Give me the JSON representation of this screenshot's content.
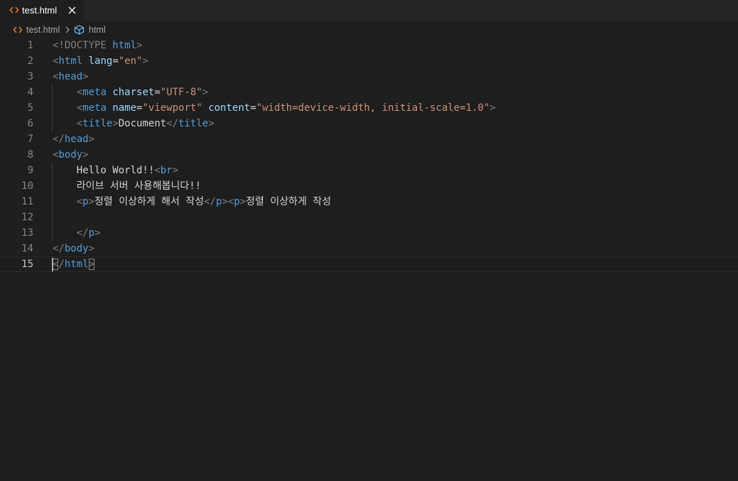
{
  "tab": {
    "label": "test.html",
    "icon": "html-file-icon",
    "close_icon": "close-icon",
    "accent": "#e37933"
  },
  "breadcrumb": {
    "file": "test.html",
    "element": "html",
    "separator_icon": "chevron-right-icon",
    "element_icon": "cube-icon"
  },
  "editor": {
    "current_line": 15,
    "lines": [
      {
        "num": "1",
        "tokens": [
          {
            "t": "<!DOCTYPE ",
            "c": "t-br"
          },
          {
            "t": "html",
            "c": "t-tag"
          },
          {
            "t": ">",
            "c": "t-br"
          }
        ]
      },
      {
        "num": "2",
        "tokens": [
          {
            "t": "<",
            "c": "t-br"
          },
          {
            "t": "html",
            "c": "t-tag"
          },
          {
            "t": " ",
            "c": "t-txt"
          },
          {
            "t": "lang",
            "c": "t-attr"
          },
          {
            "t": "=",
            "c": "t-txt"
          },
          {
            "t": "\"en\"",
            "c": "t-str"
          },
          {
            "t": ">",
            "c": "t-br"
          }
        ]
      },
      {
        "num": "3",
        "tokens": [
          {
            "t": "<",
            "c": "t-br"
          },
          {
            "t": "head",
            "c": "t-tag"
          },
          {
            "t": ">",
            "c": "t-br"
          }
        ]
      },
      {
        "num": "4",
        "tokens": [
          {
            "t": "    ",
            "c": "t-txt"
          },
          {
            "t": "<",
            "c": "t-br"
          },
          {
            "t": "meta",
            "c": "t-tag"
          },
          {
            "t": " ",
            "c": "t-txt"
          },
          {
            "t": "charset",
            "c": "t-attr"
          },
          {
            "t": "=",
            "c": "t-txt"
          },
          {
            "t": "\"UTF-8\"",
            "c": "t-str"
          },
          {
            "t": ">",
            "c": "t-br"
          }
        ]
      },
      {
        "num": "5",
        "tokens": [
          {
            "t": "    ",
            "c": "t-txt"
          },
          {
            "t": "<",
            "c": "t-br"
          },
          {
            "t": "meta",
            "c": "t-tag"
          },
          {
            "t": " ",
            "c": "t-txt"
          },
          {
            "t": "name",
            "c": "t-attr"
          },
          {
            "t": "=",
            "c": "t-txt"
          },
          {
            "t": "\"viewport\"",
            "c": "t-str"
          },
          {
            "t": " ",
            "c": "t-txt"
          },
          {
            "t": "content",
            "c": "t-attr"
          },
          {
            "t": "=",
            "c": "t-txt"
          },
          {
            "t": "\"width=device-width, initial-scale=1.0\"",
            "c": "t-str"
          },
          {
            "t": ">",
            "c": "t-br"
          }
        ]
      },
      {
        "num": "6",
        "tokens": [
          {
            "t": "    ",
            "c": "t-txt"
          },
          {
            "t": "<",
            "c": "t-br"
          },
          {
            "t": "title",
            "c": "t-tag"
          },
          {
            "t": ">",
            "c": "t-br"
          },
          {
            "t": "Document",
            "c": "t-txt"
          },
          {
            "t": "</",
            "c": "t-br"
          },
          {
            "t": "title",
            "c": "t-tag"
          },
          {
            "t": ">",
            "c": "t-br"
          }
        ]
      },
      {
        "num": "7",
        "tokens": [
          {
            "t": "</",
            "c": "t-br"
          },
          {
            "t": "head",
            "c": "t-tag"
          },
          {
            "t": ">",
            "c": "t-br"
          }
        ]
      },
      {
        "num": "8",
        "tokens": [
          {
            "t": "<",
            "c": "t-br"
          },
          {
            "t": "body",
            "c": "t-tag"
          },
          {
            "t": ">",
            "c": "t-br"
          }
        ]
      },
      {
        "num": "9",
        "tokens": [
          {
            "t": "    Hello World!!",
            "c": "t-txt"
          },
          {
            "t": "<",
            "c": "t-br"
          },
          {
            "t": "br",
            "c": "t-tag"
          },
          {
            "t": ">",
            "c": "t-br"
          }
        ]
      },
      {
        "num": "10",
        "tokens": [
          {
            "t": "    라이브 서버 사용해봅니다!!",
            "c": "t-txt"
          }
        ]
      },
      {
        "num": "11",
        "tokens": [
          {
            "t": "    ",
            "c": "t-txt"
          },
          {
            "t": "<",
            "c": "t-br"
          },
          {
            "t": "p",
            "c": "t-tag"
          },
          {
            "t": ">",
            "c": "t-br"
          },
          {
            "t": "정렬 이상하게 해서 작성",
            "c": "t-txt"
          },
          {
            "t": "</",
            "c": "t-br"
          },
          {
            "t": "p",
            "c": "t-tag"
          },
          {
            "t": ">",
            "c": "t-br"
          },
          {
            "t": "<",
            "c": "t-br"
          },
          {
            "t": "p",
            "c": "t-tag"
          },
          {
            "t": ">",
            "c": "t-br"
          },
          {
            "t": "정렬 이상하게 작성",
            "c": "t-txt"
          }
        ]
      },
      {
        "num": "12",
        "tokens": []
      },
      {
        "num": "13",
        "tokens": [
          {
            "t": "    ",
            "c": "t-txt"
          },
          {
            "t": "</",
            "c": "t-br"
          },
          {
            "t": "p",
            "c": "t-tag"
          },
          {
            "t": ">",
            "c": "t-br"
          }
        ]
      },
      {
        "num": "14",
        "tokens": [
          {
            "t": "</",
            "c": "t-br"
          },
          {
            "t": "body",
            "c": "t-tag"
          },
          {
            "t": ">",
            "c": "t-br"
          }
        ]
      },
      {
        "num": "15",
        "tokens": [
          {
            "t": "<",
            "c": "t-br t-match"
          },
          {
            "t": "/",
            "c": "t-br"
          },
          {
            "t": "html",
            "c": "t-tag"
          },
          {
            "t": ">",
            "c": "t-br t-match"
          }
        ]
      }
    ]
  }
}
